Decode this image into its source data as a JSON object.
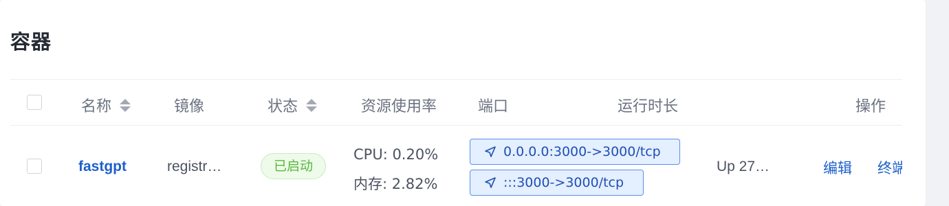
{
  "section": {
    "title": "容器"
  },
  "table": {
    "headers": {
      "name": "名称",
      "image": "镜像",
      "status": "状态",
      "usage": "资源使用率",
      "ports": "端口",
      "uptime": "运行时长",
      "actions": "操作"
    },
    "rows": [
      {
        "name": "fastgpt",
        "image": "registr…",
        "status": "已启动",
        "cpu": "CPU: 0.20%",
        "memory": "内存: 2.82%",
        "ports": [
          "0.0.0.0:3000->3000/tcp",
          ":::3000->3000/tcp"
        ],
        "uptime": "Up 27…",
        "actions": [
          "编辑",
          "终端"
        ]
      }
    ]
  },
  "icons": {
    "sort": "sort-icon",
    "port": "navigation-arrow-icon"
  },
  "colors": {
    "link": "#1e5fcc",
    "status_running_text": "#58b93a",
    "status_running_bg": "#eefaea",
    "port_tag_bg": "#e4efff",
    "port_tag_border": "#5a8ef0"
  }
}
